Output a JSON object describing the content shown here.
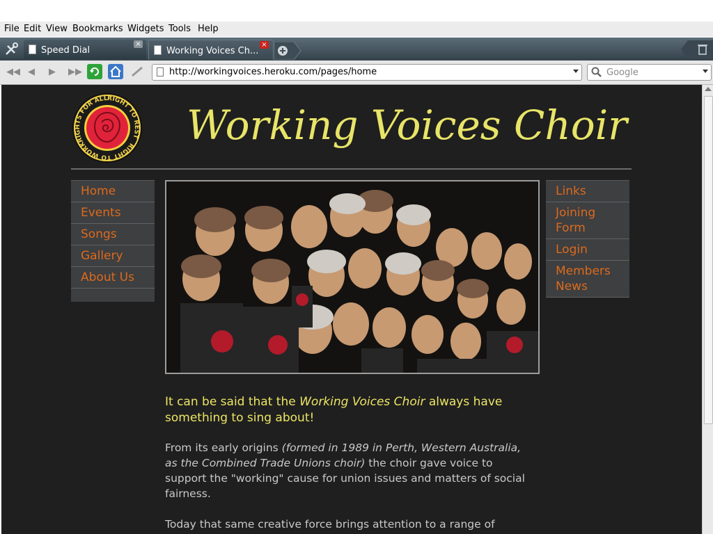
{
  "browser": {
    "menu": [
      "File",
      "Edit",
      "View",
      "Bookmarks",
      "Widgets",
      "Tools",
      "Help"
    ],
    "tabs": [
      {
        "label": "Speed Dial",
        "active": false
      },
      {
        "label": "Working Voices Ch...",
        "active": true
      }
    ],
    "url": "http://workingvoices.heroku.com/pages/home",
    "search_placeholder": "Google"
  },
  "site": {
    "title": "Working Voices Choir",
    "logo": {
      "ring_text": [
        "RIGHT TO REST",
        "RIGHT TO WORK",
        "RIGHTS FOR ALL"
      ],
      "colors": {
        "ring": "#111111",
        "band": "#f2d24a",
        "rose": "#e0233a"
      }
    },
    "left_menu": [
      "Home",
      "Events",
      "Songs",
      "Gallery",
      "About Us"
    ],
    "right_menu": [
      "Links",
      "Joining Form",
      "Login",
      "Members News"
    ],
    "lead": {
      "before": "It can be said that the ",
      "em": "Working Voices Choir",
      "after": " always have something to sing about!"
    },
    "para1": {
      "before": "From its early origins ",
      "em": "(formed in 1989 in Perth, Western Australia, as the Combined Trade Unions choir)",
      "after": " the choir gave voice to support the \"working\" cause for union issues and matters of social fairness."
    },
    "para2": "Today that same creative force brings attention to a range of"
  },
  "colors": {
    "accent_yellow": "#e8e468",
    "menu_orange": "#dd6a1c",
    "page_bg": "#1f1f1f"
  }
}
